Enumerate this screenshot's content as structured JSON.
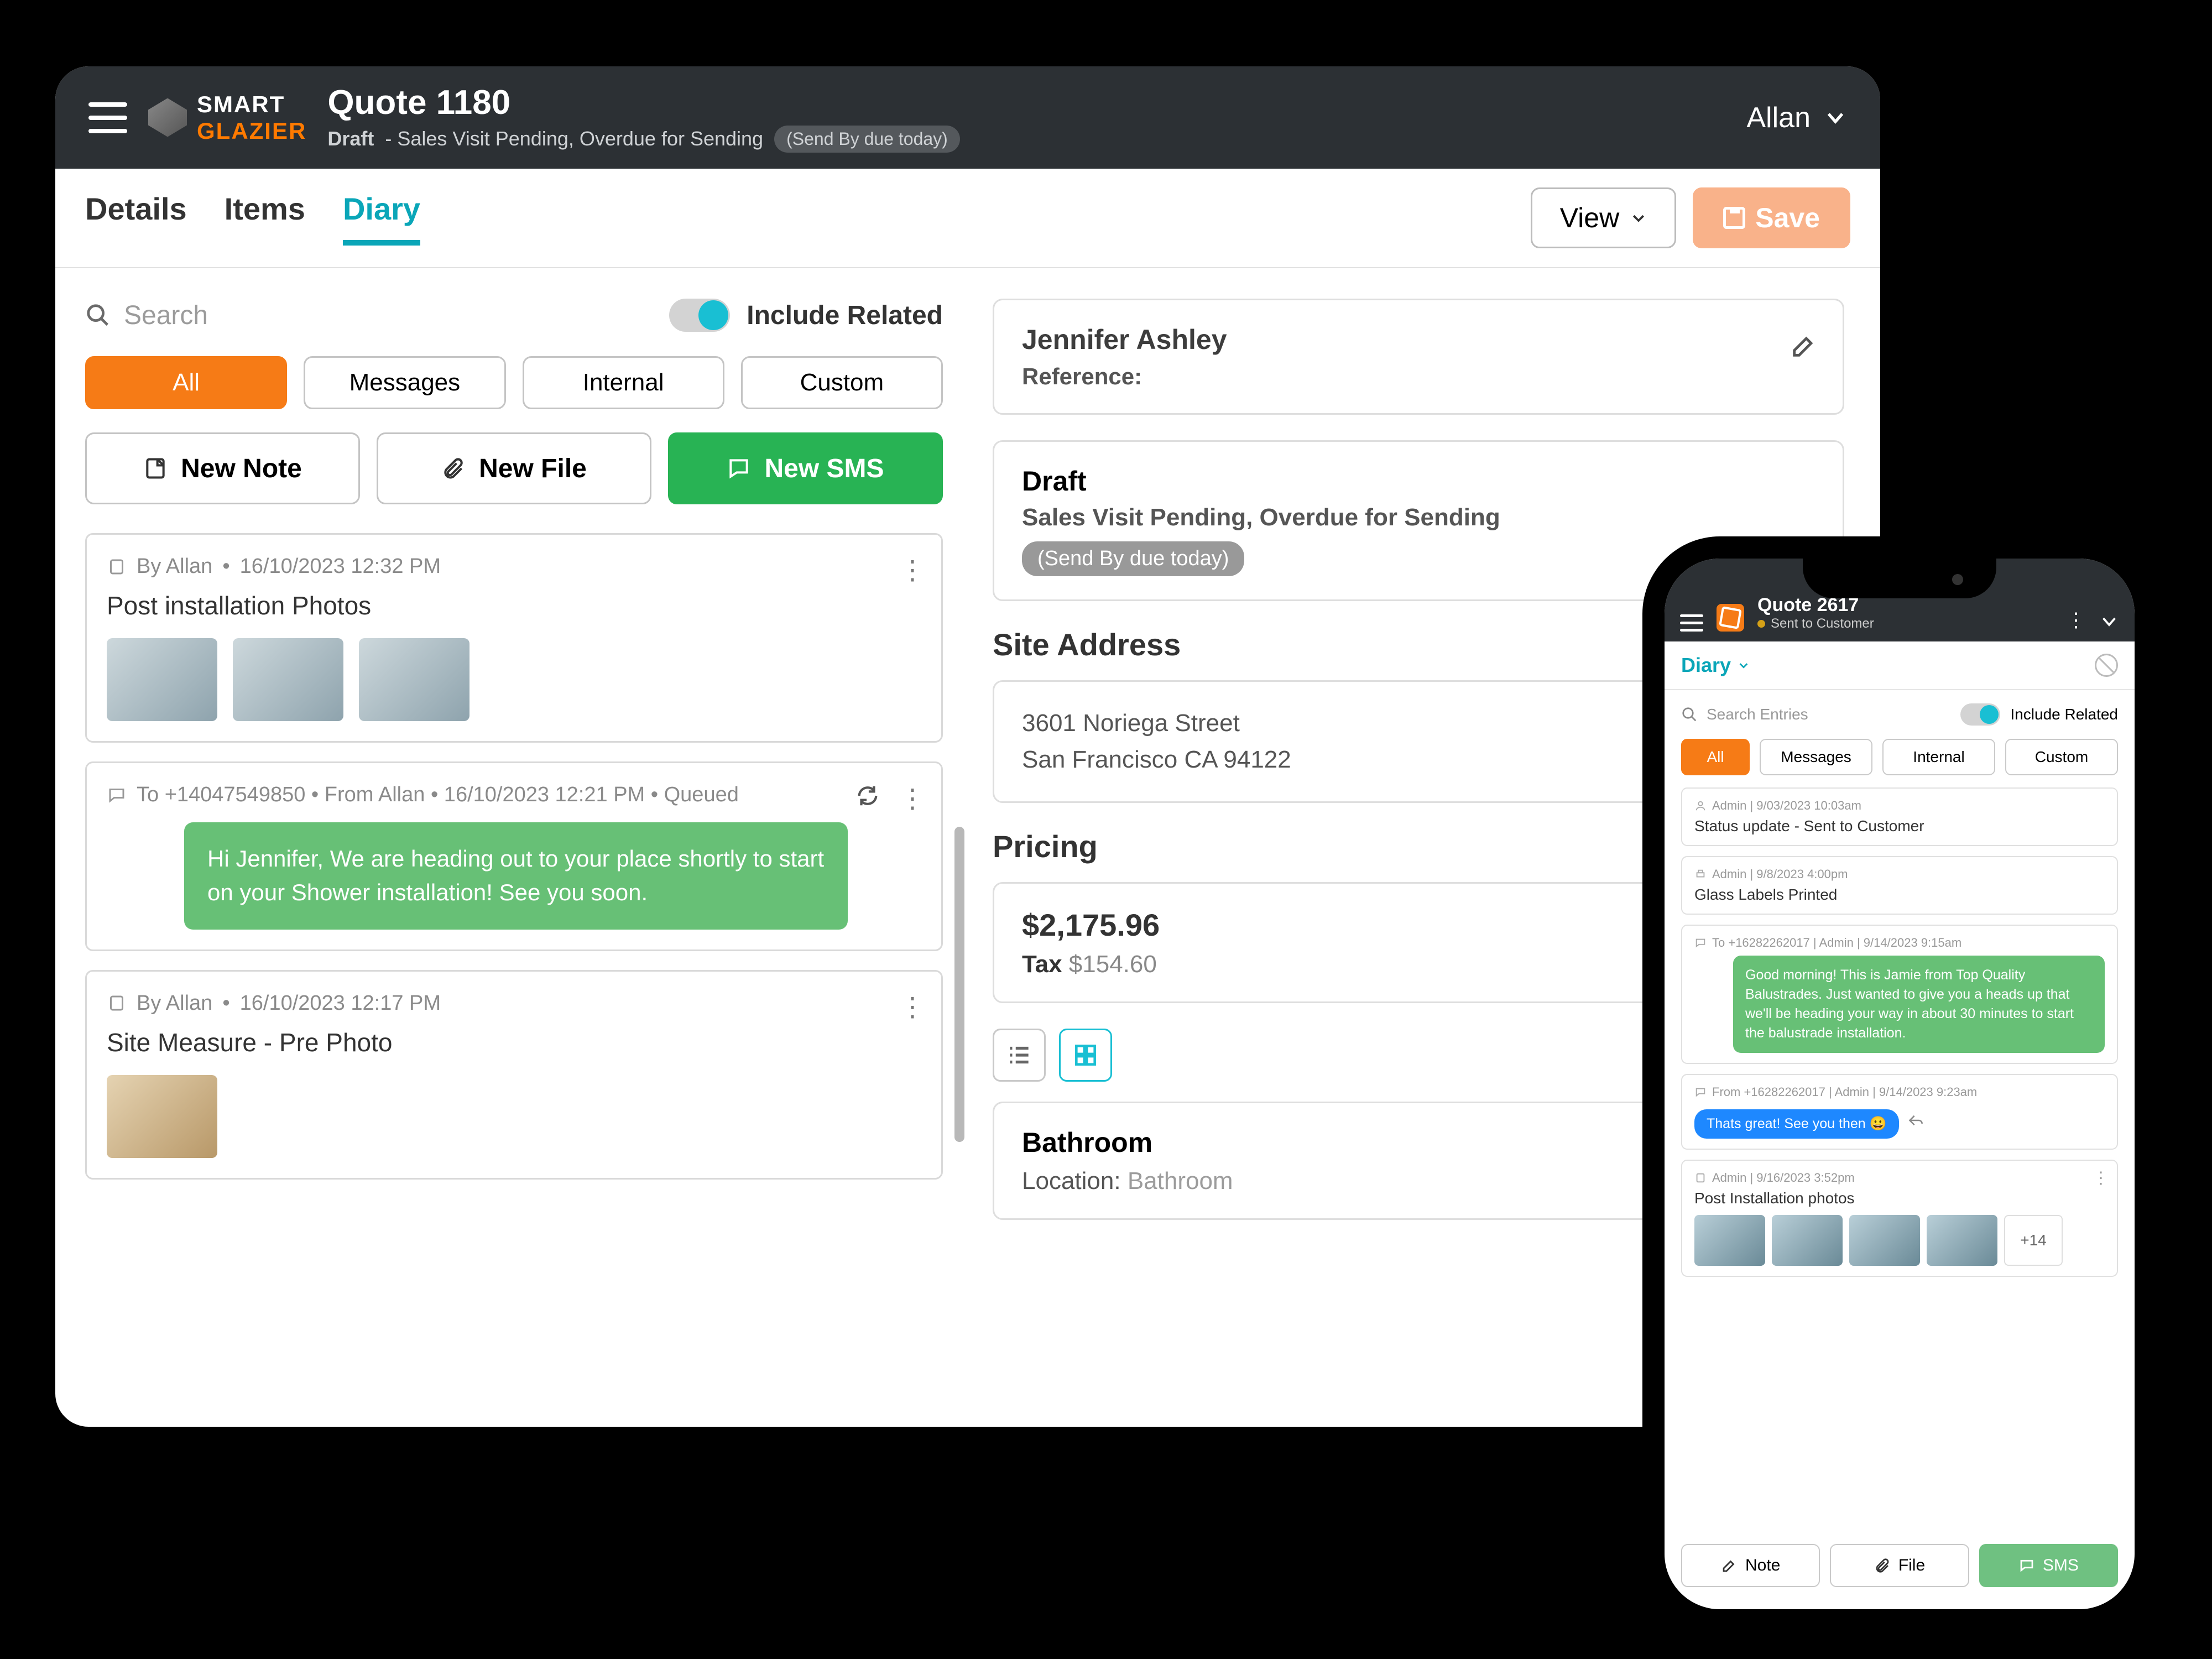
{
  "tablet": {
    "brand_top": "SMART",
    "brand_bot": "GLAZIER",
    "header": {
      "title": "Quote 1180",
      "status_prefix": "Draft",
      "status_text": " - Sales Visit Pending, Overdue for Sending",
      "badge": "(Send By due today)",
      "user": "Allan"
    },
    "tabs": {
      "details": "Details",
      "items": "Items",
      "diary": "Diary"
    },
    "view_btn": "View",
    "save_btn": "Save",
    "search_placeholder": "Search",
    "include_related": "Include Related",
    "filters": {
      "all": "All",
      "messages": "Messages",
      "internal": "Internal",
      "custom": "Custom"
    },
    "buttons": {
      "note": "New Note",
      "file": "New File",
      "sms": "New SMS"
    },
    "entries": [
      {
        "by": "By Allan",
        "ts": "16/10/2023 12:32 PM",
        "title": "Post installation Photos"
      },
      {
        "meta": "To +14047549850 • From Allan • 16/10/2023 12:21 PM • Queued",
        "body": "Hi Jennifer,\nWe are heading out to your place shortly to start on your Shower installation! See you soon."
      },
      {
        "by": "By Allan",
        "ts": "16/10/2023 12:17 PM",
        "title": "Site Measure - Pre Photo"
      }
    ],
    "customer": {
      "name": "Jennifer Ashley",
      "reference_label": "Reference:"
    },
    "status_card": {
      "stage": "Draft",
      "detail": "Sales Visit Pending, Overdue for Sending",
      "badge": "(Send By due today)"
    },
    "site_address": {
      "label": "Site Address",
      "line1": "3601 Noriega Street",
      "line2": "San Francisco CA 94122"
    },
    "pricing": {
      "label": "Pricing",
      "total": "$2,175.96",
      "tax_label": "Tax",
      "tax": "$154.60"
    },
    "room": {
      "name": "Bathroom",
      "loc_label": "Location:",
      "loc": "Bathroom"
    }
  },
  "phone": {
    "header": {
      "title": "Quote 2617",
      "status": "Sent to Customer"
    },
    "diary_label": "Diary",
    "search_placeholder": "Search Entries",
    "include_related": "Include Related",
    "filters": {
      "all": "All",
      "messages": "Messages",
      "internal": "Internal",
      "custom": "Custom"
    },
    "feed": [
      {
        "meta": "Admin | 9/03/2023 10:03am",
        "title": "Status update - Sent to Customer"
      },
      {
        "meta": "Admin | 9/8/2023 4:00pm",
        "title": "Glass Labels Printed"
      },
      {
        "meta": "To +16282262017 | Admin | 9/14/2023 9:15am",
        "body": "Good morning! This is Jamie from Top Quality Balustrades. Just wanted to give you a heads up that we'll be heading your way in about 30 minutes to start the balustrade installation."
      },
      {
        "meta": "From +16282262017 | Admin | 9/14/2023 9:23am",
        "reply": "Thats great! See you then 😀"
      },
      {
        "meta": "Admin | 9/16/2023 3:52pm",
        "title": "Post Installation photos",
        "more": "+14"
      }
    ],
    "footer": {
      "note": "Note",
      "file": "File",
      "sms": "SMS"
    }
  }
}
